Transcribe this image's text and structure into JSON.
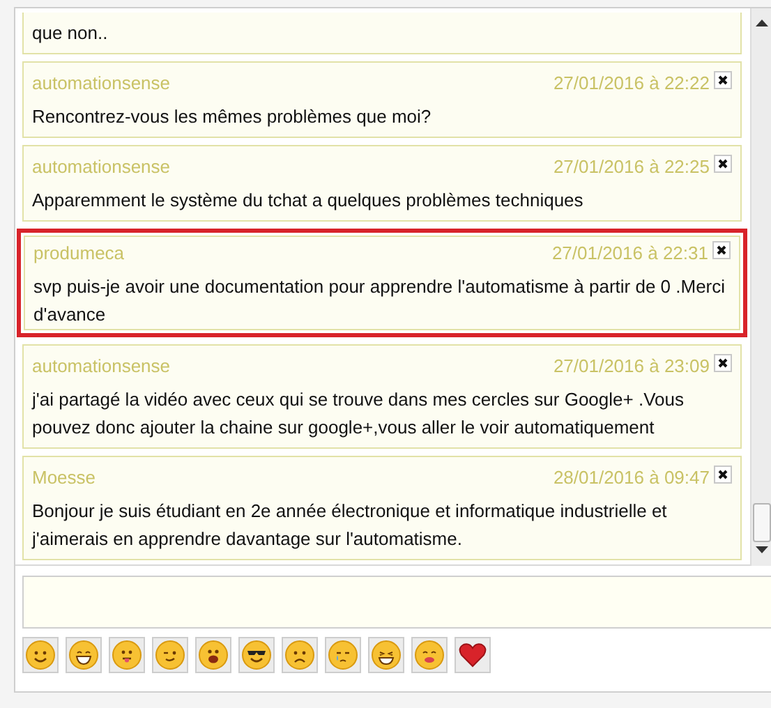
{
  "messages": [
    {
      "body": "que non..",
      "highlighted": false
    },
    {
      "author": "automationsense",
      "time": "27/01/2016 à 22:22",
      "body": "Rencontrez-vous les mêmes problèmes que moi?",
      "highlighted": false
    },
    {
      "author": "automationsense",
      "time": "27/01/2016 à 22:25",
      "body": "Apparemment le système du tchat a quelques problèmes techniques",
      "highlighted": false
    },
    {
      "author": "produmeca",
      "time": "27/01/2016 à 22:31",
      "body": "svp puis-je avoir une documentation pour apprendre l'automatisme à partir de 0 .Merci d'avance",
      "highlighted": true
    },
    {
      "author": "automationsense",
      "time": "27/01/2016 à 23:09",
      "body": "j'ai partagé la vidéo avec ceux qui se trouve dans mes cercles sur Google+ .Vous pouvez donc ajouter la chaine sur google+,vous aller le voir automatiquement",
      "highlighted": false
    },
    {
      "author": "Moesse",
      "time": "28/01/2016 à 09:47",
      "body": "Bonjour je suis étudiant en 2e année électronique et informatique industrielle et j'aimerais en apprendre davantage sur l'automatisme.",
      "highlighted": false
    }
  ],
  "emoticons": [
    {
      "kind": "smile"
    },
    {
      "kind": "grin"
    },
    {
      "kind": "tongue"
    },
    {
      "kind": "wink"
    },
    {
      "kind": "open"
    },
    {
      "kind": "sunglasses"
    },
    {
      "kind": "sad"
    },
    {
      "kind": "cry"
    },
    {
      "kind": "laugh"
    },
    {
      "kind": "kiss"
    },
    {
      "kind": "heart"
    }
  ]
}
